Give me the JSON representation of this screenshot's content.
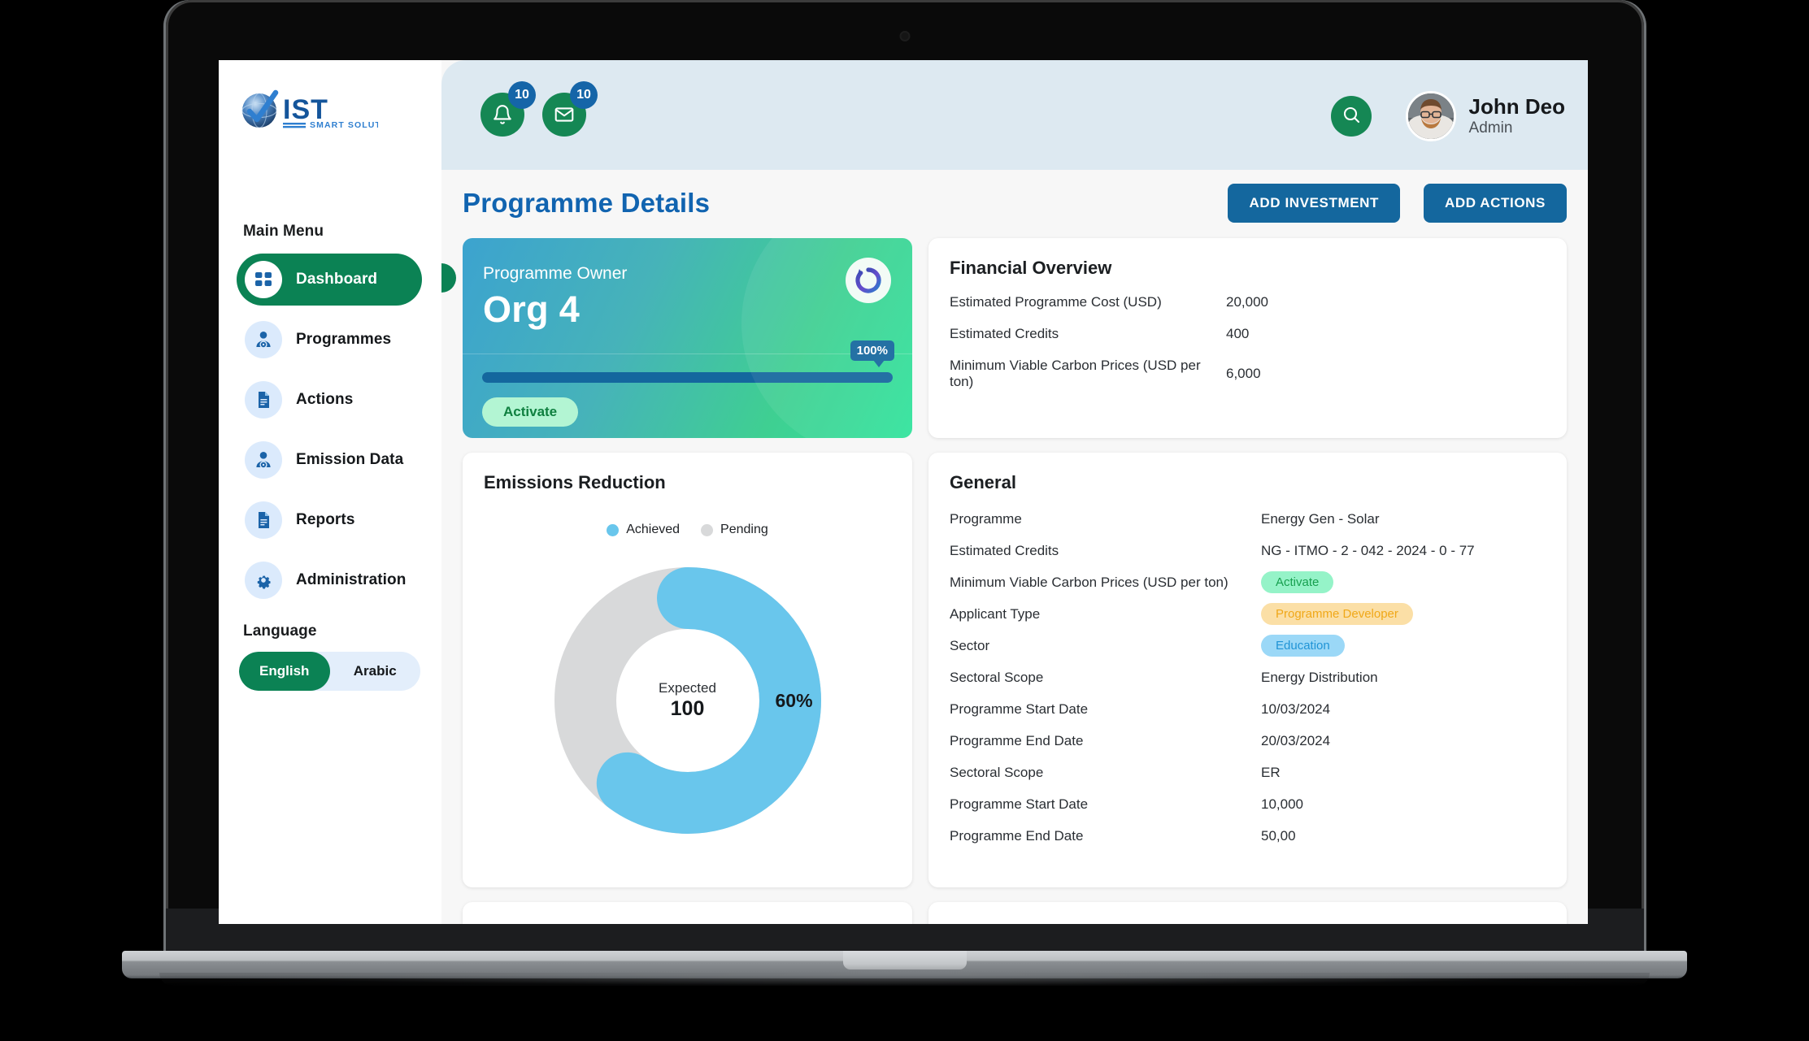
{
  "brand": {
    "name": "IST",
    "tagline": "SMART SOLUTIONS"
  },
  "sidebar": {
    "main_menu_heading": "Main Menu",
    "items": [
      {
        "label": "Dashboard",
        "icon": "grid-icon",
        "active": true
      },
      {
        "label": "Programmes",
        "icon": "person-gear-icon",
        "active": false
      },
      {
        "label": "Actions",
        "icon": "document-icon",
        "active": false
      },
      {
        "label": "Emission Data",
        "icon": "person-gear-icon",
        "active": false
      },
      {
        "label": "Reports",
        "icon": "document-icon",
        "active": false
      },
      {
        "label": "Administration",
        "icon": "gear-icon",
        "active": false
      }
    ],
    "language_heading": "Language",
    "languages": [
      {
        "label": "English",
        "active": true
      },
      {
        "label": "Arabic",
        "active": false
      }
    ]
  },
  "topbar": {
    "notification_badge": "10",
    "message_badge": "10",
    "search_icon": "search-icon",
    "user_name": "John Deo",
    "user_role": "Admin"
  },
  "page": {
    "title": "Programme Details",
    "buttons": {
      "add_investment": "ADD INVESTMENT",
      "add_actions": "ADD ACTIONS"
    }
  },
  "owner_card": {
    "label": "Programme Owner",
    "name": "Org 4",
    "progress_percent": "100%",
    "progress_value": 100,
    "status": "Activate",
    "refresh_icon": "refresh-icon"
  },
  "financial_overview": {
    "title": "Financial Overview",
    "rows": [
      {
        "key": "Estimated Programme Cost (USD)",
        "value": "20,000"
      },
      {
        "key": "Estimated Credits",
        "value": "400"
      },
      {
        "key": "Minimum Viable Carbon Prices (USD per ton)",
        "value": "6,000"
      }
    ]
  },
  "emissions": {
    "title": "Emissions Reduction",
    "center_label": "Expected",
    "center_value": "100",
    "percent_label": "60%"
  },
  "chart_data": {
    "type": "pie",
    "title": "Emissions Reduction",
    "categories": [
      "Achieved",
      "Pending"
    ],
    "values": [
      60,
      40
    ],
    "value_labels": [
      "60%",
      ""
    ],
    "colors": [
      "#69c6ec",
      "#d8d9da"
    ],
    "center_label": "Expected",
    "center_value": 100,
    "legend_position": "top",
    "donut": true,
    "start_angle": -90,
    "rounded_caps": true
  },
  "general": {
    "title": "General",
    "rows": [
      {
        "key": "Programme",
        "value": "Energy Gen - Solar",
        "type": "text"
      },
      {
        "key": "Estimated Credits",
        "value": "NG - ITMO - 2 - 042 - 2024 - 0 - 77",
        "type": "text"
      },
      {
        "key": "Minimum Viable Carbon Prices (USD per ton)",
        "value": "Activate",
        "type": "tag-activate"
      },
      {
        "key": "Applicant Type",
        "value": "Programme Developer",
        "type": "tag-developer"
      },
      {
        "key": "Sector",
        "value": "Education",
        "type": "tag-education"
      },
      {
        "key": "Sectoral Scope",
        "value": "Energy Distribution",
        "type": "text"
      },
      {
        "key": "Programme Start Date",
        "value": "10/03/2024",
        "type": "text"
      },
      {
        "key": "Programme End Date",
        "value": "20/03/2024",
        "type": "text"
      },
      {
        "key": "Sectoral Scope",
        "value": "ER",
        "type": "text"
      },
      {
        "key": "Programme Start Date",
        "value": "10,000",
        "type": "text"
      },
      {
        "key": "Programme End Date",
        "value": "50,00",
        "type": "text"
      }
    ]
  },
  "colors": {
    "brand_green": "#0b8254",
    "brand_blue": "#14679e",
    "title_blue": "#1164b0",
    "header_bg": "#dde9f1",
    "achieved": "#69c6ec",
    "pending": "#d8d9da"
  }
}
